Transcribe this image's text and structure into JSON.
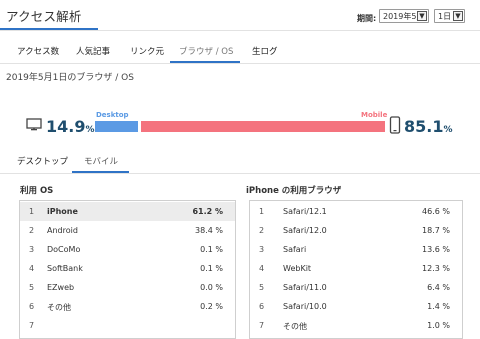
{
  "header": {
    "title": "アクセス解析",
    "period_label": "期間:",
    "month_value": "2019年5月",
    "day_value": "1日"
  },
  "nav": {
    "tabs": [
      {
        "label": "アクセス数"
      },
      {
        "label": "人気記事"
      },
      {
        "label": "リンク元"
      },
      {
        "label": "ブラウザ / OS"
      },
      {
        "label": "生ログ"
      }
    ]
  },
  "subtitle": "2019年5月1日のブラウザ / OS",
  "device": {
    "desktop_value": "14.9",
    "mobile_value": "85.1",
    "unit": "%",
    "desktop_label": "Desktop",
    "mobile_label": "Mobile",
    "desktop_share": 0.149,
    "mobile_share": 0.851,
    "desktop_color": "#5b9ae4",
    "mobile_color": "#f4737e"
  },
  "device_tabs": [
    {
      "label": "デスクトップ"
    },
    {
      "label": "モバイル"
    }
  ],
  "os_section": {
    "title": "利用 OS",
    "rows": [
      {
        "num": "1",
        "name": "iPhone",
        "value": "61.2 %"
      },
      {
        "num": "2",
        "name": "Android",
        "value": "38.4 %"
      },
      {
        "num": "3",
        "name": "DoCoMo",
        "value": "0.1 %"
      },
      {
        "num": "4",
        "name": "SoftBank",
        "value": "0.1 %"
      },
      {
        "num": "5",
        "name": "EZweb",
        "value": "0.0 %"
      },
      {
        "num": "6",
        "name": "その他",
        "value": "0.2 %"
      },
      {
        "num": "7",
        "name": "",
        "value": ""
      }
    ]
  },
  "browser_section": {
    "title": "iPhone の利用ブラウザ",
    "rows": [
      {
        "num": "1",
        "name": "Safari/12.1",
        "value": "46.6 %"
      },
      {
        "num": "2",
        "name": "Safari/12.0",
        "value": "18.7 %"
      },
      {
        "num": "3",
        "name": "Safari",
        "value": "13.6 %"
      },
      {
        "num": "4",
        "name": "WebKit",
        "value": "12.3 %"
      },
      {
        "num": "5",
        "name": "Safari/11.0",
        "value": "6.4 %"
      },
      {
        "num": "6",
        "name": "Safari/10.0",
        "value": "1.4 %"
      },
      {
        "num": "7",
        "name": "その他",
        "value": "1.0 %"
      }
    ]
  }
}
